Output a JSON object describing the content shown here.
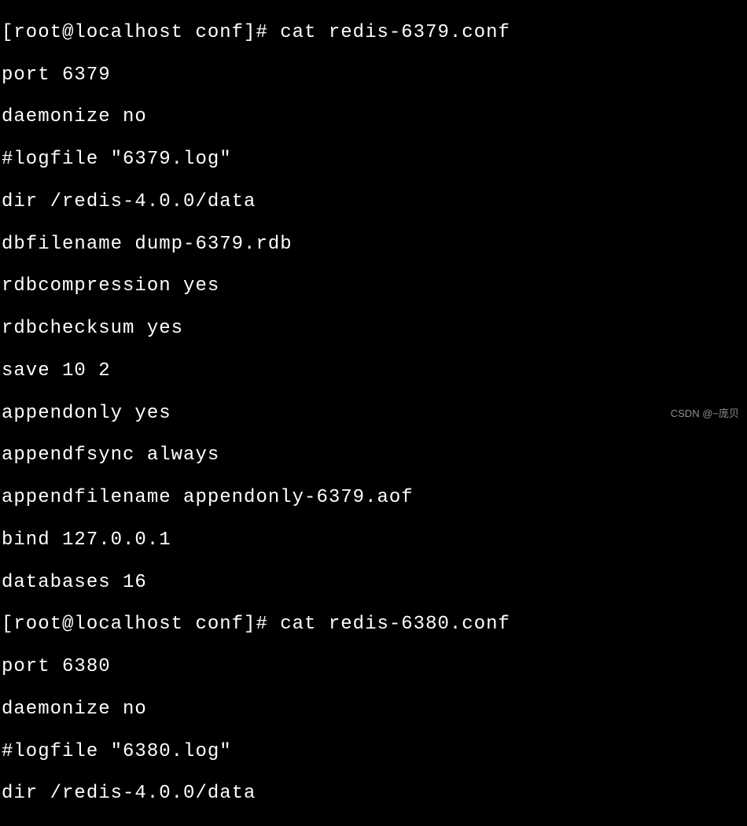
{
  "terminal": {
    "lines": [
      "[root@localhost conf]# cat redis-6379.conf",
      "port 6379",
      "daemonize no",
      "#logfile \"6379.log\"",
      "dir /redis-4.0.0/data",
      "dbfilename dump-6379.rdb",
      "rdbcompression yes",
      "rdbchecksum yes",
      "save 10 2",
      "appendonly yes",
      "appendfsync always",
      "appendfilename appendonly-6379.aof",
      "bind 127.0.0.1",
      "databases 16",
      "[root@localhost conf]# cat redis-6380.conf",
      "port 6380",
      "daemonize no",
      "#logfile \"6380.log\"",
      "dir /redis-4.0.0/data"
    ]
  },
  "watermark": {
    "text": "CSDN @~庞贝"
  }
}
